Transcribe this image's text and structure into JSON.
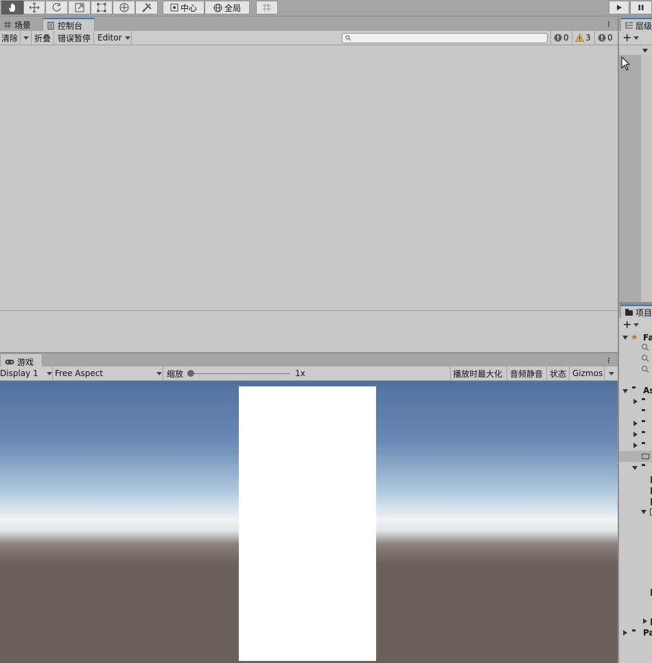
{
  "toolbar": {
    "tools": [
      "hand-tool",
      "move-tool",
      "rotate-tool",
      "scale-tool",
      "rect-tool",
      "transform-tool",
      "custom-tool"
    ],
    "pivot_label": "中心",
    "space_label": "全局"
  },
  "top_tabs": {
    "scene_label": "场景",
    "console_label": "控制台"
  },
  "console": {
    "clear_label": "清除",
    "collapse_label": "折叠",
    "error_pause_label": "错误暂停",
    "editor_label": "Editor",
    "search_placeholder": "",
    "info_count": "0",
    "warning_count": "3",
    "error_count": "0"
  },
  "game": {
    "tab_label": "游戏",
    "display_label": "Display 1",
    "aspect_label": "Free Aspect",
    "scale_label": "缩放",
    "scale_value": "1x",
    "maximize_label": "播放时最大化",
    "mute_label": "音频静音",
    "stats_label": "状态",
    "gizmos_label": "Gizmos"
  },
  "hierarchy": {
    "tab_label": "层级"
  },
  "project": {
    "tab_label": "项目",
    "favorites_label": "Fa",
    "assets_label": "As",
    "packages_label": "Pa"
  },
  "colors": {
    "sky_top": "#52709e",
    "horizon": "#eef3f6",
    "ground": "#6c605a",
    "accent": "#3a79bb"
  }
}
